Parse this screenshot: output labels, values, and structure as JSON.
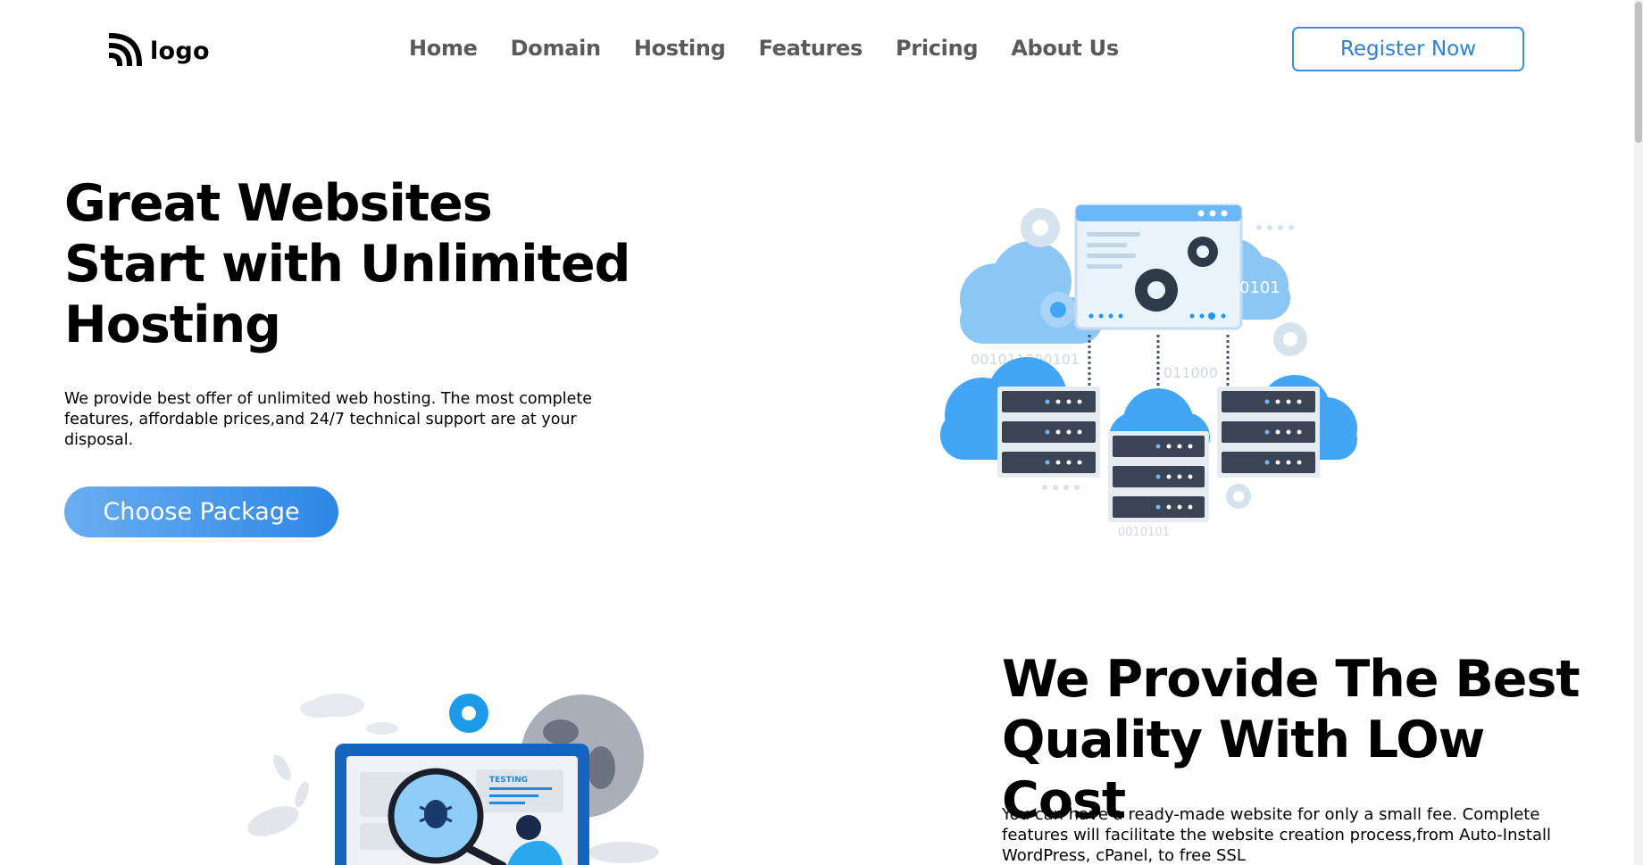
{
  "header": {
    "logo_text": "logo",
    "nav": [
      "Home",
      "Domain",
      "Hosting",
      "Features",
      "Pricing",
      "About Us"
    ],
    "register_label": "Register Now"
  },
  "hero": {
    "title": "Great Websites Start with Unlimited Hosting",
    "description": "We provide best offer of unlimited web hosting. The most complete features, affordable prices,and 24/7 technical support are at your disposal.",
    "cta_label": "Choose Package",
    "illustration_text": {
      "binary_1": "0101",
      "binary_2": "001011000101",
      "binary_3": "011000",
      "binary_4": "0010101"
    }
  },
  "section2": {
    "title": "We Provide The Best Quality With LOw Cost",
    "description": "You can have a ready-made website for only a small fee. Complete features will facilitate the website creation process,from Auto-Install WordPress, cPanel, to free SSL",
    "illustration_text": "TESTING"
  },
  "colors": {
    "accent": "#2d86e6",
    "cloud": "#42a5f5",
    "server": "#3b4453",
    "nav_text": "#5a5a5a"
  }
}
